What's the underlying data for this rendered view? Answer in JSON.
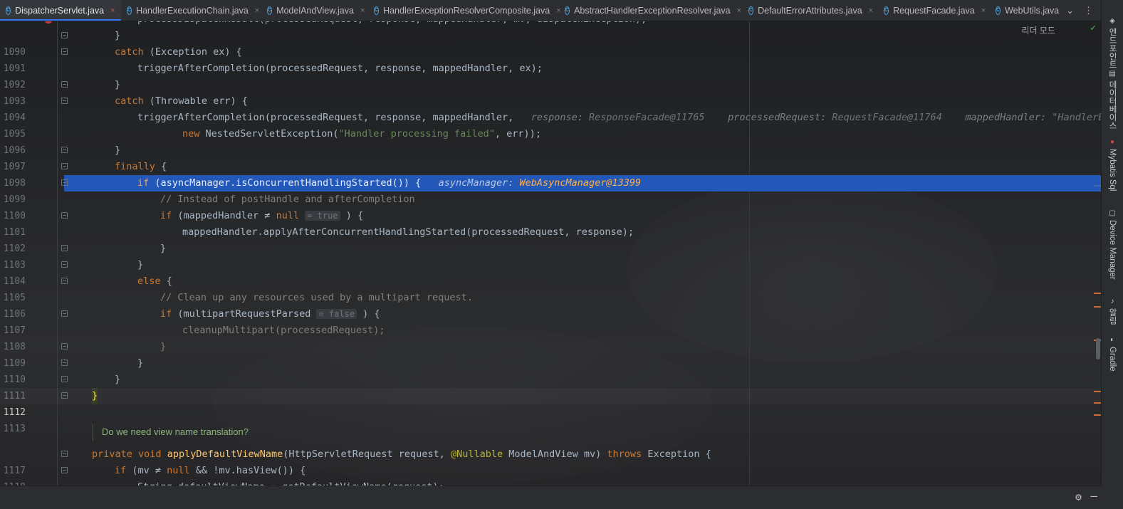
{
  "tabs": [
    {
      "name": "DispatcherServlet.java",
      "active": true
    },
    {
      "name": "HandlerExecutionChain.java",
      "active": false
    },
    {
      "name": "ModelAndView.java",
      "active": false
    },
    {
      "name": "HandlerExceptionResolverComposite.java",
      "active": false
    },
    {
      "name": "AbstractHandlerExceptionResolver.java",
      "active": false
    },
    {
      "name": "DefaultErrorAttributes.java",
      "active": false
    },
    {
      "name": "RequestFacade.java",
      "active": false
    },
    {
      "name": "WebUtils.java",
      "active": false
    }
  ],
  "tab_close_glyph": "×",
  "tabs_more_glyph": "⌄",
  "tabs_menu_glyph": "⋮",
  "reader_mode_label": "리더 모드",
  "check_glyph": "✓",
  "lines": {
    "l1090": {
      "num": "1090",
      "t": "}"
    },
    "l1091": {
      "num": "1091",
      "kw": "catch",
      "t": " (Exception ex) {"
    },
    "l1092": {
      "num": "1092",
      "t": "triggerAfterCompletion(processedRequest, response, mappedHandler, ex);"
    },
    "l1093": {
      "num": "1093",
      "t": "}"
    },
    "l1094": {
      "num": "1094",
      "kw": "catch",
      "t": " (Throwable err) {"
    },
    "l1095": {
      "num": "1095",
      "t": "triggerAfterCompletion(processedRequest, response, mappedHandler,",
      "h1": "response:",
      "v1": "ResponseFacade@11765",
      "h2": "processedRequest:",
      "v2": "RequestFacade@11764",
      "h3": "mappedHandler:",
      "v3": "\"HandlerExec"
    },
    "l1096": {
      "num": "1096",
      "kw": "new",
      "t1": " NestedServletException(",
      "s": "\"Handler processing failed\"",
      "t2": ", err));"
    },
    "l1097": {
      "num": "1097",
      "t": "}"
    },
    "l1098": {
      "num": "1098",
      "kw": "finally",
      "t": " {"
    },
    "l1099": {
      "num": "1099",
      "kw": "if",
      "t": " (asyncManager.isConcurrentHandlingStarted()) {",
      "h": "asyncManager:",
      "v": "WebAsyncManager@13399"
    },
    "l1100": {
      "num": "1100",
      "c": "// Instead of postHandle and afterCompletion"
    },
    "l1101": {
      "num": "1101",
      "kw": "if",
      "t1": " (mappedHandler ≠ ",
      "kw2": "null",
      "inlay": "= true",
      "t2": " ) {"
    },
    "l1102": {
      "num": "1102",
      "t": "mappedHandler.applyAfterConcurrentHandlingStarted(processedRequest, response);"
    },
    "l1103": {
      "num": "1103",
      "t": "}"
    },
    "l1104": {
      "num": "1104",
      "t": "}"
    },
    "l1105": {
      "num": "1105",
      "kw": "else",
      "t": " {"
    },
    "l1106": {
      "num": "1106",
      "c": "// Clean up any resources used by a multipart request."
    },
    "l1107": {
      "num": "1107",
      "kw": "if",
      "t1": " (multipartRequestParsed ",
      "inlay": "= false",
      "t2": " ) {"
    },
    "l1108": {
      "num": "1108",
      "t": "cleanupMultipart(processedRequest);"
    },
    "l1109": {
      "num": "1109",
      "t": "}"
    },
    "l1110": {
      "num": "1110",
      "t": "}"
    },
    "l1111": {
      "num": "1111",
      "t": "}"
    },
    "l1112": {
      "num": "1112",
      "t": "}"
    },
    "l1113": {
      "num": "1113",
      "t": ""
    },
    "l1117": {
      "num": "1117",
      "kw": "private void",
      "fn": "applyDefaultViewName",
      "t1": "(HttpServletRequest request, ",
      "ann": "@Nullable",
      "t2": " ModelAndView mv) ",
      "kw2": "throws",
      "t3": " Exception {"
    },
    "l1118": {
      "num": "1118",
      "kw": "if",
      "t1": " (mv ≠ ",
      "kw2": "null",
      "t2": " && !mv.hasView()) {"
    }
  },
  "doc_comment": "Do we need view name translation?",
  "right_tools": [
    {
      "label": "엔드포인트",
      "icon": "endpoints-icon"
    },
    {
      "label": "데이터베이스",
      "icon": "database-icon"
    },
    {
      "label": "Mybatis Sql",
      "icon": "mybatis-icon"
    },
    {
      "label": "Device Manager",
      "icon": "device-manager-icon"
    },
    {
      "label": "알림",
      "icon": "notifications-icon"
    },
    {
      "label": "Gradle",
      "icon": "gradle-icon"
    }
  ],
  "bottom": {
    "gear_glyph": "⚙",
    "minimize_glyph": "—"
  },
  "colors": {
    "accent": "#3574f0",
    "exec_line": "#2358b8",
    "breakpoint": "#c9413a",
    "keyword": "#cc7832",
    "string": "#6a8759",
    "comment": "#808080"
  }
}
